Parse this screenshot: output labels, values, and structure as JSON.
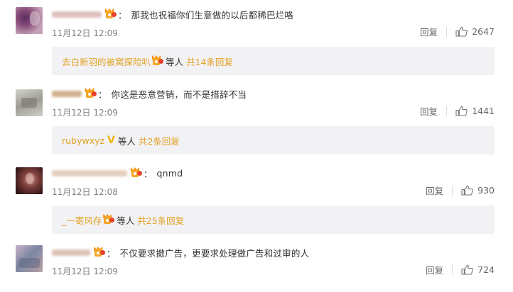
{
  "comments": [
    {
      "id": "c1",
      "separator": "：",
      "text": "那我也祝福你们生意做的以后都稀巴烂咯",
      "time": "11月12日 12:09",
      "reply_label": "回复",
      "like_count": "2647",
      "sub": {
        "user": "去白新羽的被窝探险叭",
        "has_badge": true,
        "mid": "等人",
        "more": "共14条回复"
      }
    },
    {
      "id": "c2",
      "separator": "：",
      "text": "你这是恶意营销，而不是措辞不当",
      "time": "11月12日 12:09",
      "reply_label": "回复",
      "like_count": "1441",
      "sub": {
        "user": "rubywxyz",
        "has_v": true,
        "v_mark": "V",
        "mid": "等人",
        "more": "共2条回复"
      }
    },
    {
      "id": "c3",
      "separator": "：",
      "text": "qnmd",
      "time": "11月12日 12:08",
      "reply_label": "回复",
      "like_count": "930",
      "sub": {
        "user": "_一寄风存",
        "has_badge": true,
        "mid": "等人",
        "more": "共25条回复"
      }
    },
    {
      "id": "c4",
      "separator": "：",
      "text": "不仅要求撤广告，更要求处理做广告和过审的人",
      "time": "11月12日 12:09",
      "reply_label": "回复",
      "like_count": "724"
    }
  ],
  "colors": {
    "link": "#e3a021",
    "meta": "#808080",
    "sub_bg": "#f2f2f5",
    "text": "#333333"
  },
  "icons": {
    "badge": "vip-badge-icon",
    "like": "thumbs-up-icon",
    "verified": "verified-v-icon"
  }
}
